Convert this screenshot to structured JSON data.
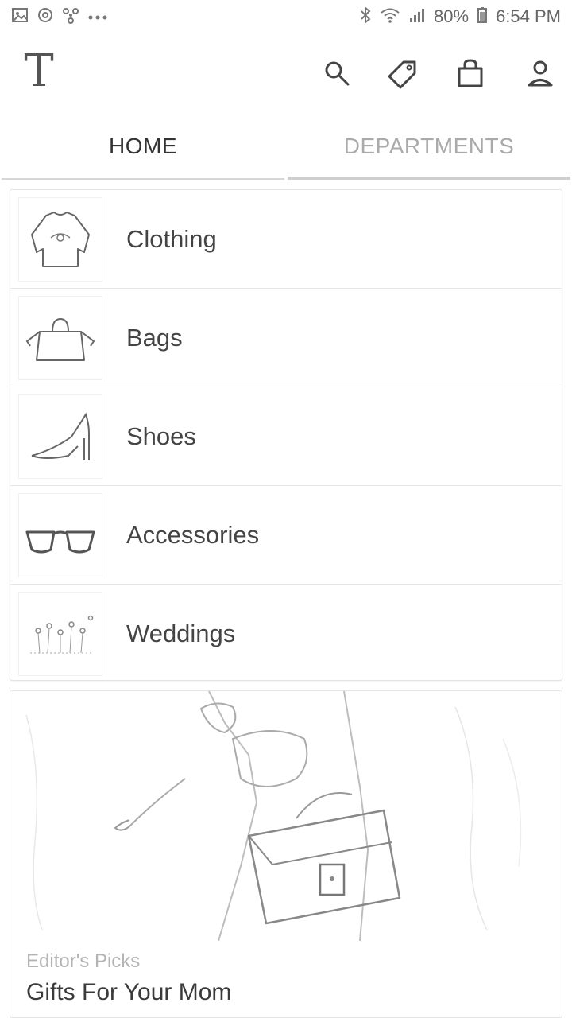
{
  "status_bar": {
    "battery": "80%",
    "time": "6:54 PM",
    "left_icons": [
      "gallery-icon",
      "sync-icon",
      "pinwheel-icon",
      "more-dots-icon"
    ],
    "right_icons": [
      "bluetooth-icon",
      "wifi-icon",
      "signal-icon",
      "battery-icon"
    ]
  },
  "app_bar": {
    "logo": "T",
    "actions": [
      "search-icon",
      "tag-icon",
      "shopping-bag-icon",
      "profile-icon"
    ]
  },
  "tabs": [
    {
      "label": "HOME",
      "active": true
    },
    {
      "label": "DEPARTMENTS",
      "active": false
    }
  ],
  "categories": [
    {
      "label": "Clothing",
      "icon": "sweater-icon"
    },
    {
      "label": "Bags",
      "icon": "handbag-icon"
    },
    {
      "label": "Shoes",
      "icon": "high-heel-icon"
    },
    {
      "label": "Accessories",
      "icon": "glasses-icon"
    },
    {
      "label": "Weddings",
      "icon": "flowers-icon"
    }
  ],
  "editor_card": {
    "kicker": "Editor's Picks",
    "title": "Gifts For Your Mom"
  },
  "colors": {
    "text_primary": "#333333",
    "text_muted": "#aaaaaa",
    "divider": "#e6e6e6"
  }
}
